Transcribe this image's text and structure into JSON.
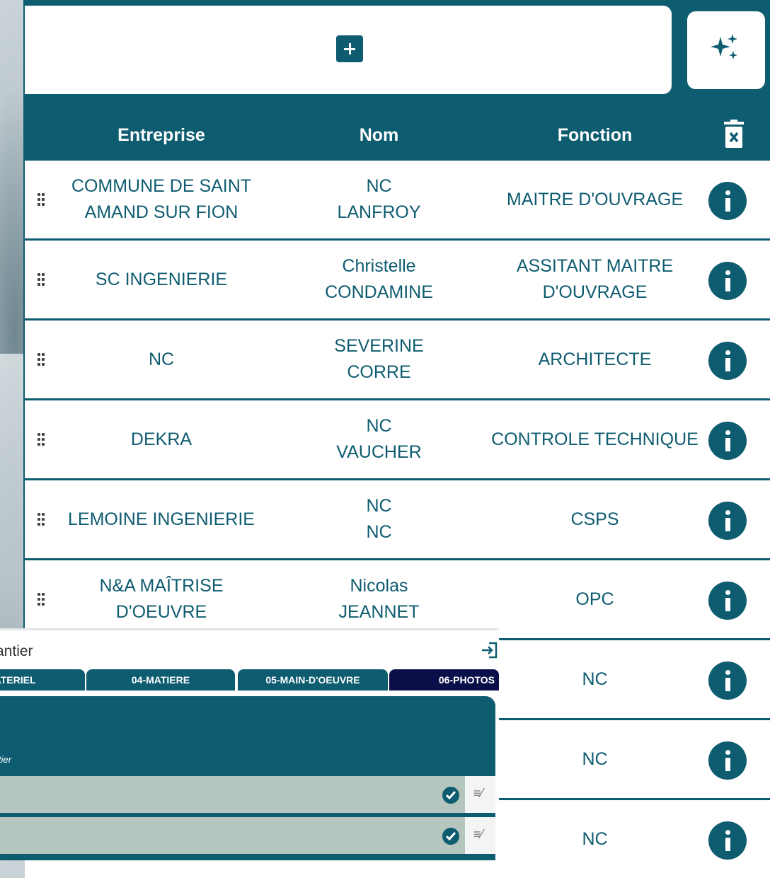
{
  "table": {
    "headers": [
      "Entreprise",
      "Nom",
      "Fonction"
    ],
    "rows": [
      {
        "entreprise": [
          "COMMUNE DE SAINT",
          "AMAND SUR FION"
        ],
        "nom": [
          "NC",
          "LANFROY"
        ],
        "fonction": [
          "MAITRE D'OUVRAGE"
        ]
      },
      {
        "entreprise": [
          "SC INGENIERIE"
        ],
        "nom": [
          "Christelle",
          "CONDAMINE"
        ],
        "fonction": [
          "ASSITANT MAITRE",
          "D'OUVRAGE"
        ]
      },
      {
        "entreprise": [
          "NC"
        ],
        "nom": [
          "SEVERINE",
          "CORRE"
        ],
        "fonction": [
          "ARCHITECTE"
        ]
      },
      {
        "entreprise": [
          "DEKRA"
        ],
        "nom": [
          "NC",
          "VAUCHER"
        ],
        "fonction": [
          "CONTROLE TECHNIQUE"
        ]
      },
      {
        "entreprise": [
          "LEMOINE INGENIERIE"
        ],
        "nom": [
          "NC",
          "NC"
        ],
        "fonction": [
          "CSPS"
        ]
      },
      {
        "entreprise": [
          "N&A MAÎTRISE",
          "D'OEUVRE"
        ],
        "nom": [
          "Nicolas",
          "JEANNET"
        ],
        "fonction": [
          "OPC"
        ]
      },
      {
        "entreprise": [],
        "nom": [],
        "fonction": [
          "NC"
        ]
      },
      {
        "entreprise": [],
        "nom": [],
        "fonction": [
          "NC"
        ]
      },
      {
        "entreprise": [],
        "nom": [],
        "fonction": [
          "NC"
        ]
      }
    ]
  },
  "toolbar": {
    "add_icon": "plus-icon",
    "ai_icon": "sparkles-icon",
    "delete_icon": "trash-x-icon"
  },
  "row_icons": {
    "handle": "drag-handle-icon",
    "info": "info-icon"
  },
  "subwindow": {
    "title": "antier",
    "tabs": [
      "MATERIEL",
      "04-MATIERE",
      "05-MAIN-D'OEUVRE",
      "06-PHOTOS"
    ],
    "active_tab": "06-PHOTOS",
    "hint": "tier",
    "exit_icon": "exit-icon",
    "row_icons": [
      "check-circle-icon",
      "edit-list-icon"
    ]
  },
  "colors": {
    "primary": "#0e5c70",
    "active_tab": "#0a0f4a",
    "row_highlight": "#b4c6bd"
  }
}
